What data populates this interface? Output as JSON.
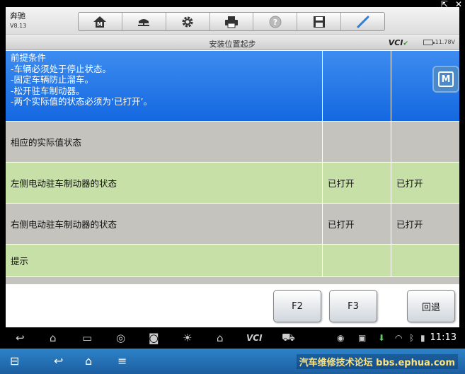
{
  "header": {
    "brand": "奔驰",
    "version": "V8.13",
    "toolbar": [
      "home-icon",
      "car-lift-icon",
      "gear-icon",
      "printer-icon",
      "help-icon",
      "save-icon",
      "pen-icon"
    ]
  },
  "titlebar": {
    "title": "安装位置起步",
    "vci": "VCI",
    "battery": "11.78V"
  },
  "table": {
    "precondition": {
      "lines": [
        "前提条件",
        "-车辆必须处于停止状态。",
        "-固定车辆防止溜车。",
        "-松开驻车制动器。",
        "-两个实际值的状态必须为‘已打开’。"
      ]
    },
    "rows": [
      {
        "label": "相应的实际值状态",
        "v1": "",
        "v2": ""
      },
      {
        "label": "左侧电动驻车制动器的状态",
        "v1": "已打开",
        "v2": "已打开"
      },
      {
        "label": "右侧电动驻车制动器的状态",
        "v1": "已打开",
        "v2": "已打开"
      },
      {
        "label": "提示",
        "v1": "",
        "v2": ""
      }
    ]
  },
  "side_button": {
    "label": "M"
  },
  "fkeys": {
    "f2": "F2",
    "f3": "F3",
    "back": "回退"
  },
  "navbar": {
    "clock": "11:13",
    "vci": "VCI"
  },
  "bottombar": {
    "watermark": "汽车维修技术论坛 bbs.ephua.com"
  }
}
